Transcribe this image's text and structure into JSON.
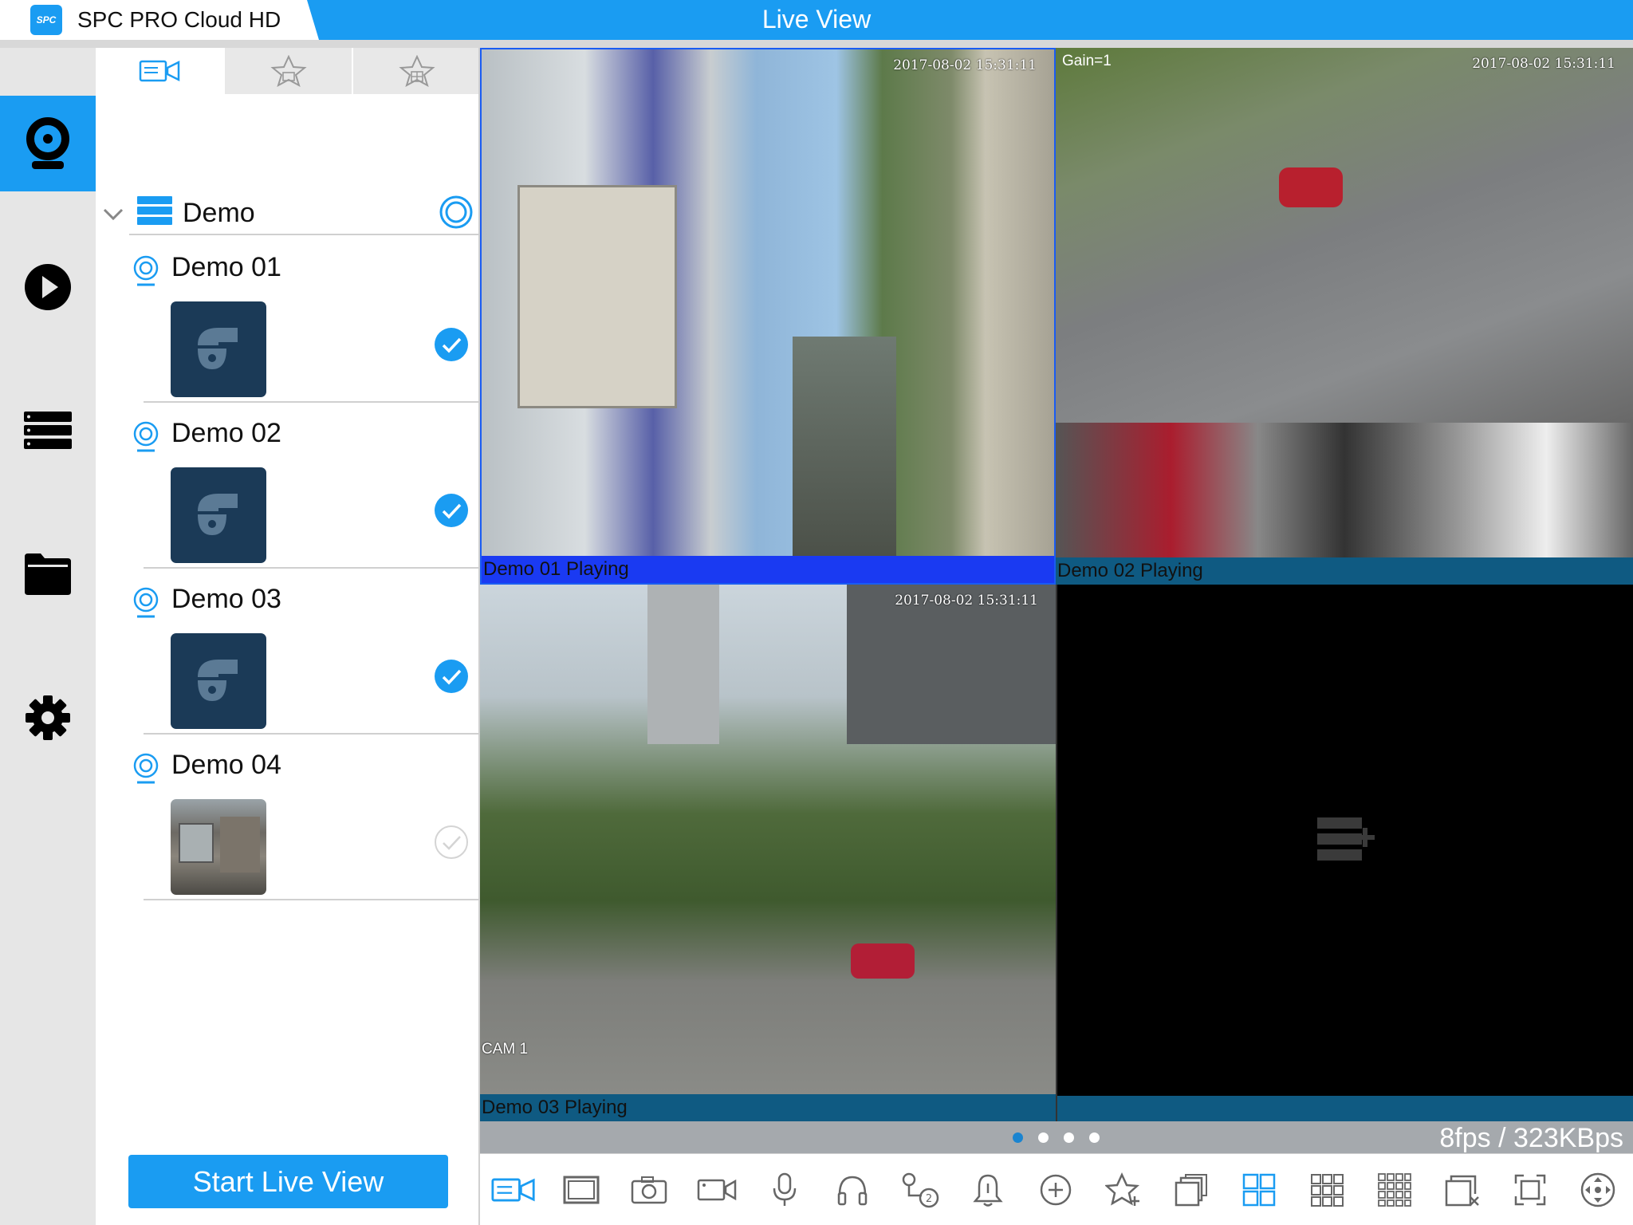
{
  "app": {
    "title": "SPC PRO Cloud HD",
    "logo_text": "SPC",
    "view_title": "Live View",
    "accent": "#1a9cf2"
  },
  "sidebar": {
    "items": [
      {
        "name": "live-view",
        "icon": "webcam-icon",
        "active": true
      },
      {
        "name": "playback",
        "icon": "play-icon",
        "active": false
      },
      {
        "name": "devices",
        "icon": "server-list-icon",
        "active": false
      },
      {
        "name": "files",
        "icon": "folder-icon",
        "active": false
      },
      {
        "name": "settings",
        "icon": "gear-icon",
        "active": false
      }
    ]
  },
  "panel": {
    "tabs": [
      {
        "icon": "camera-list-icon",
        "selected": true
      },
      {
        "icon": "star-camera-icon",
        "selected": false
      },
      {
        "icon": "star-grid-icon",
        "selected": false
      }
    ],
    "group": {
      "name": "Demo"
    },
    "cameras": [
      {
        "name": "Demo 01",
        "checked": true,
        "thumb": "ptz-camera-icon"
      },
      {
        "name": "Demo 02",
        "checked": true,
        "thumb": "ptz-camera-icon"
      },
      {
        "name": "Demo 03",
        "checked": true,
        "thumb": "ptz-camera-icon"
      },
      {
        "name": "Demo 04",
        "checked": false,
        "thumb": "snapshot"
      }
    ],
    "start_button": "Start Live View"
  },
  "views": [
    {
      "caption": "Demo 01  Playing",
      "timestamp": "2017-08-02  15:31:11",
      "active": true
    },
    {
      "caption": "Demo 02  Playing",
      "timestamp": "2017-08-02  15:31:11",
      "overlay": "Gain=1",
      "active": false
    },
    {
      "caption": "Demo 03  Playing",
      "timestamp": "2017-08-02  15:31:11",
      "overlay": "CAM 1",
      "active": false
    },
    {
      "caption": "",
      "empty": true
    }
  ],
  "pager": {
    "pages": 4,
    "current": 1,
    "stats": "8fps / 323KBps"
  },
  "toolbar": [
    "camera-list-icon",
    "single-view-icon",
    "snapshot-icon",
    "record-icon",
    "microphone-icon",
    "headphones-icon",
    "stream-switch-icon",
    "alarm-bell-icon",
    "zoom-in-icon",
    "add-favorite-icon",
    "multi-window-icon",
    "grid-4-icon",
    "grid-9-icon",
    "grid-16-icon",
    "close-all-icon",
    "fullscreen-icon",
    "ptz-icon"
  ]
}
